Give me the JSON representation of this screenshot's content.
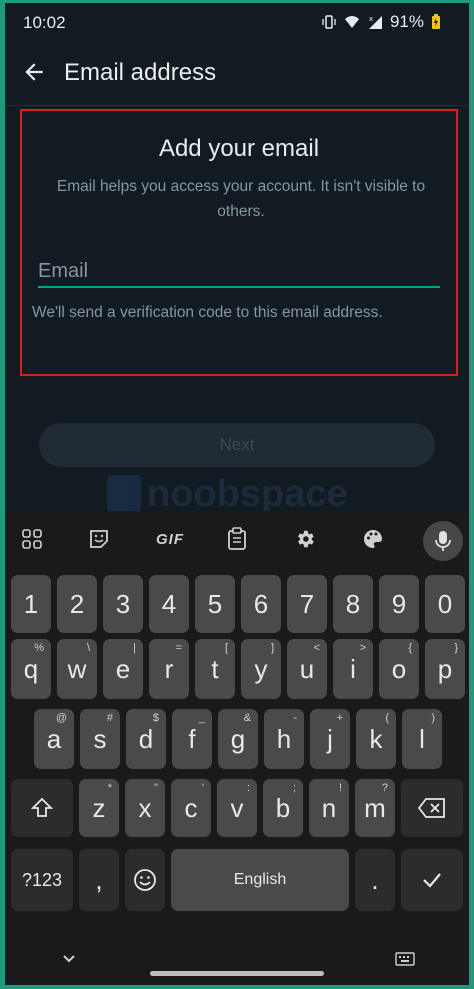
{
  "status_bar": {
    "time": "10:02",
    "battery": "91%"
  },
  "app_bar": {
    "title": "Email address"
  },
  "card": {
    "title": "Add your email",
    "description": "Email helps you access your account. It isn't visible to others.",
    "email_placeholder": "Email",
    "email_value": "",
    "helper": "We'll send a verification code to this email address."
  },
  "next_button": {
    "label": "Next"
  },
  "watermark": {
    "text": "noobspace"
  },
  "keyboard": {
    "toolbar": {
      "gif_label": "GIF"
    },
    "row_numbers": [
      "1",
      "2",
      "3",
      "4",
      "5",
      "6",
      "7",
      "8",
      "9",
      "0"
    ],
    "row_top": [
      {
        "k": "q",
        "h": "%"
      },
      {
        "k": "w",
        "h": "\\"
      },
      {
        "k": "e",
        "h": "|"
      },
      {
        "k": "r",
        "h": "="
      },
      {
        "k": "t",
        "h": "["
      },
      {
        "k": "y",
        "h": "]"
      },
      {
        "k": "u",
        "h": "<"
      },
      {
        "k": "i",
        "h": ">"
      },
      {
        "k": "o",
        "h": "{"
      },
      {
        "k": "p",
        "h": "}"
      }
    ],
    "row_middle": [
      {
        "k": "a",
        "h": "@"
      },
      {
        "k": "s",
        "h": "#"
      },
      {
        "k": "d",
        "h": "$"
      },
      {
        "k": "f",
        "h": "_"
      },
      {
        "k": "g",
        "h": "&"
      },
      {
        "k": "h",
        "h": "-"
      },
      {
        "k": "j",
        "h": "+"
      },
      {
        "k": "k",
        "h": "("
      },
      {
        "k": "l",
        "h": ")"
      }
    ],
    "row_bottom": [
      {
        "k": "z",
        "h": "*"
      },
      {
        "k": "x",
        "h": "\""
      },
      {
        "k": "c",
        "h": "'"
      },
      {
        "k": "v",
        "h": ":"
      },
      {
        "k": "b",
        "h": ";"
      },
      {
        "k": "n",
        "h": "!"
      },
      {
        "k": "m",
        "h": "?"
      }
    ],
    "symbols_key": "?123",
    "comma_key": ",",
    "space_label": "English",
    "period_key": "."
  }
}
